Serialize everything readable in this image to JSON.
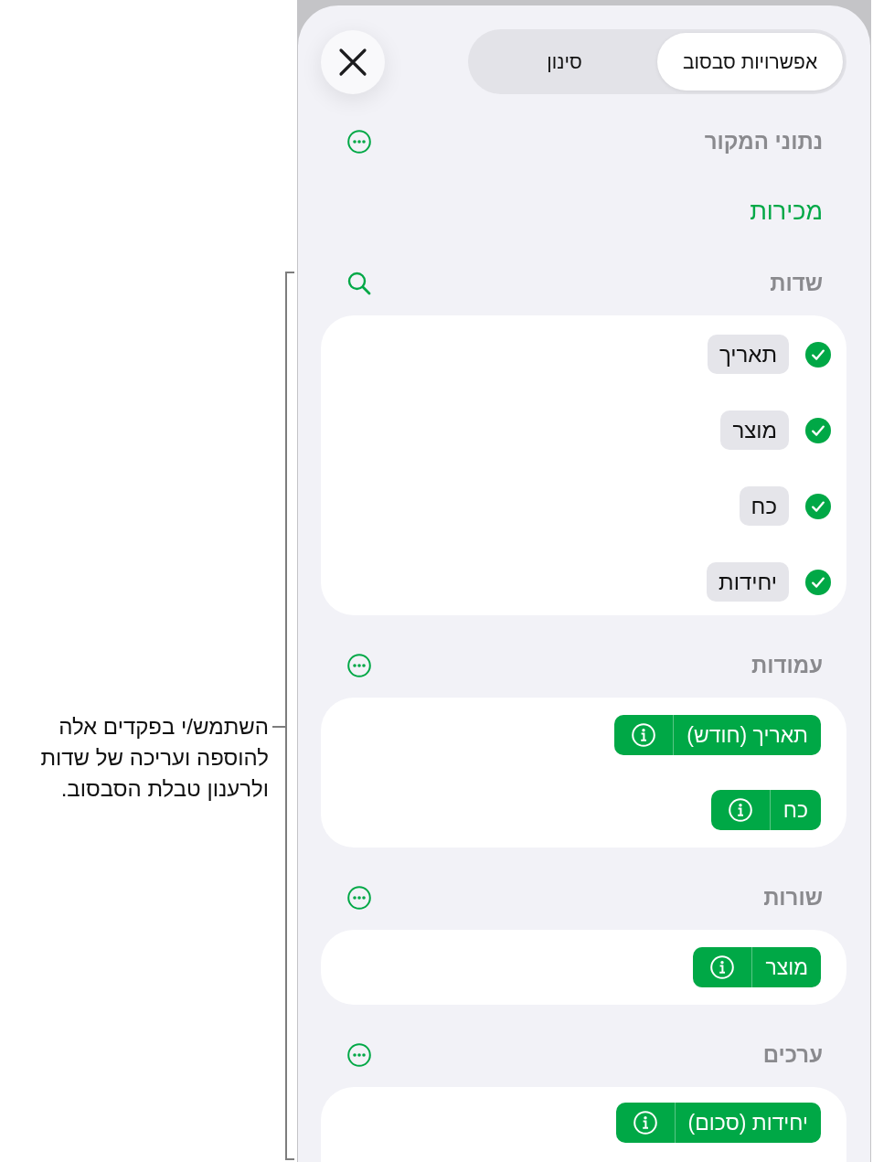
{
  "annotation": {
    "text": "השתמש/י בפקדים אלה להוספה ועריכה של שדות ולרענון טבלת הסבסוב."
  },
  "panel": {
    "tabs": [
      {
        "label": "אפשרויות סבסוב",
        "selected": true
      },
      {
        "label": "סינון",
        "selected": false
      }
    ],
    "sections": [
      {
        "kind": "source",
        "title": "נתוני המקור",
        "value": "מכירות"
      },
      {
        "kind": "checklist",
        "title": "שדות",
        "fields": [
          {
            "label": "תאריך",
            "checked": true
          },
          {
            "label": "מוצר",
            "checked": true
          },
          {
            "label": "כח",
            "checked": true
          },
          {
            "label": "יחידות",
            "checked": true
          }
        ]
      },
      {
        "kind": "pills",
        "title": "עמודות",
        "items": [
          "תאריך (חודש)",
          "כח"
        ]
      },
      {
        "kind": "pills",
        "title": "שורות",
        "items": [
          "מוצר"
        ]
      },
      {
        "kind": "pills",
        "title": "ערכים",
        "items": [
          "יחידות (סכום)"
        ]
      }
    ]
  }
}
